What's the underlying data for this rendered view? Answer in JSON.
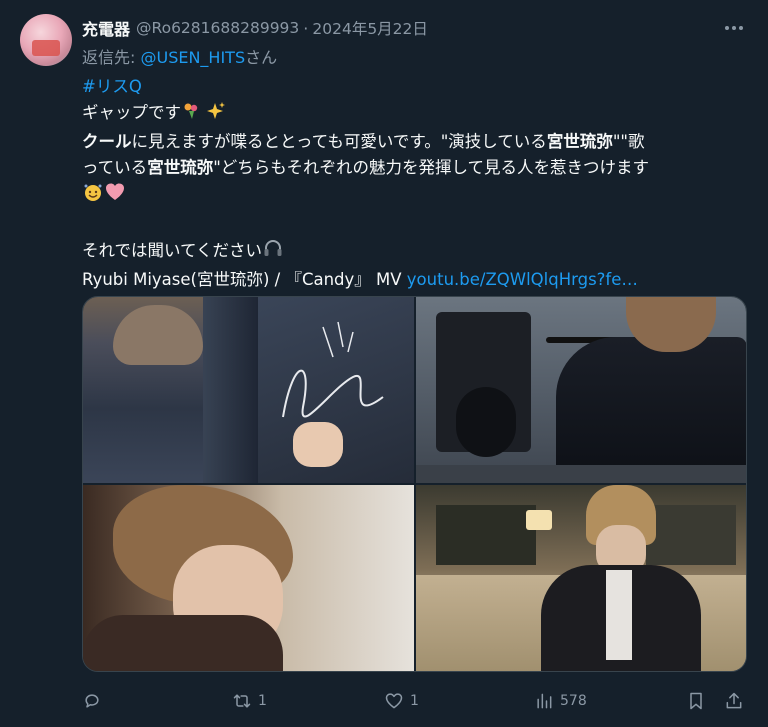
{
  "author": {
    "name": "充電器",
    "handle": "@Ro6281688289993",
    "date": "2024年5月22日"
  },
  "reply": {
    "prefix": "返信先: ",
    "target": "@USEN_HITS",
    "suffix": "さん"
  },
  "tweet": {
    "hashtag": "#リスQ",
    "line1": "ギャップです",
    "line2_bold": "クール",
    "line2_a": "に見えますが喋るととっても可愛いです。\"演技している",
    "line2_bold2": "宮世琉弥",
    "line2_b": "\"\"歌",
    "line3_a": "っている",
    "line3_bold": "宮世琉弥",
    "line3_b": "\"どちらもそれぞれの魅力を発揮して見る人を惹きつけます",
    "line5": "それでは聞いてください",
    "line6": "Ryubi Miyase(宮世琉弥) / 『Candy』 MV ",
    "url": "youtu.be/ZQWlQlqHrgs?fe…"
  },
  "actions": {
    "replies": "",
    "retweets": "1",
    "likes": "1",
    "views": "578"
  },
  "icons": {
    "more": "more-icon",
    "reply": "reply-icon",
    "retweet": "retweet-icon",
    "like": "heart-icon",
    "views": "views-icon",
    "bookmark": "bookmark-icon",
    "share": "share-icon"
  },
  "colors": {
    "background": "#15202b",
    "text": "#f7f9f9",
    "muted": "#8b98a5",
    "accent": "#1d9bf0"
  }
}
